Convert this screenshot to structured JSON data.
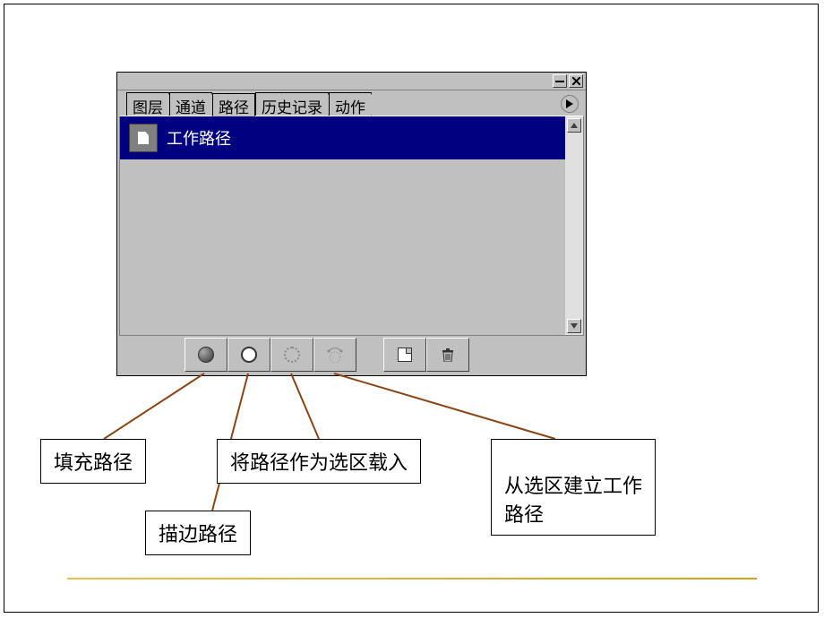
{
  "tabs": {
    "layers": "图层",
    "channels": "通道",
    "paths": "路径",
    "history": "历史记录",
    "actions": "动作"
  },
  "path_item": {
    "name": "工作路径"
  },
  "annotations": {
    "fill_path": "填充路径",
    "stroke_path": "描边路径",
    "path_to_selection": "将路径作为选区载入",
    "selection_to_path": "从选区建立工作\n路径"
  },
  "icons": {
    "fill_path": "fill-path-circle",
    "stroke_path": "stroke-path-circle",
    "path_as_selection": "dotted-selection-circle",
    "selection_to_path": "path-from-selection",
    "new_path": "new-document",
    "delete": "trash"
  }
}
